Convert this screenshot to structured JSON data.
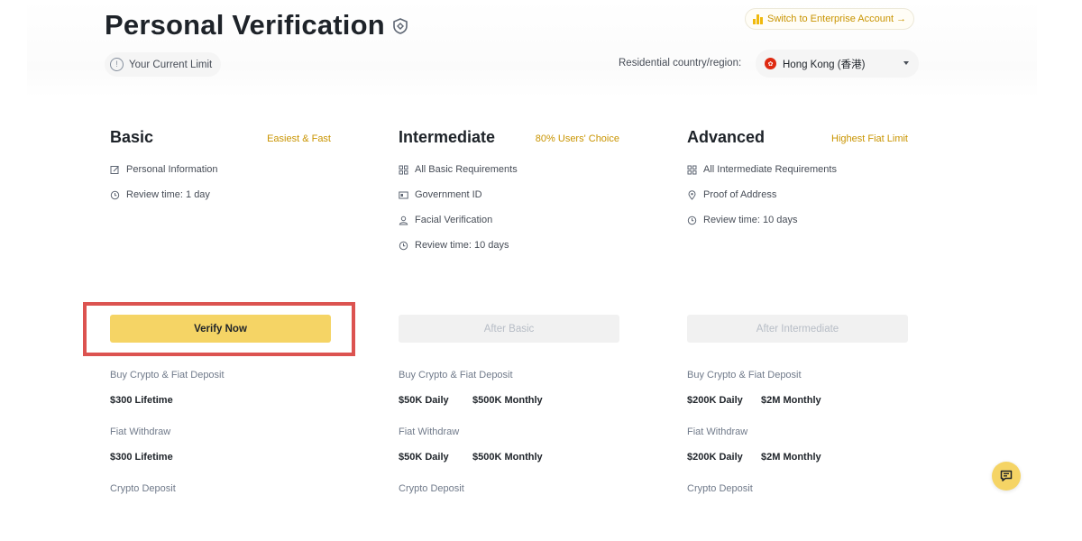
{
  "header": {
    "title": "Personal Verification",
    "current_limit": "Your Current Limit",
    "enterprise_link": "Switch to Enterprise Account →",
    "country_label": "Residential country/region:",
    "country_value": "Hong Kong (香港)"
  },
  "tiers": [
    {
      "title": "Basic",
      "tag": "Easiest & Fast",
      "requirements": [
        {
          "icon": "edit-icon",
          "text": "Personal Information"
        },
        {
          "icon": "clock-icon",
          "text": "Review time: 1 day"
        }
      ],
      "button": "Verify Now",
      "buy_label": "Buy Crypto & Fiat Deposit",
      "buy_daily": "$300 Lifetime",
      "buy_monthly": "",
      "withdraw_label": "Fiat Withdraw",
      "withdraw_daily": "$300 Lifetime",
      "withdraw_monthly": "",
      "crypto_label": "Crypto Deposit"
    },
    {
      "title": "Intermediate",
      "tag": "80% Users' Choice",
      "requirements": [
        {
          "icon": "grid-icon",
          "text": "All Basic Requirements"
        },
        {
          "icon": "id-card-icon",
          "text": "Government ID"
        },
        {
          "icon": "user-icon",
          "text": "Facial Verification"
        },
        {
          "icon": "clock-icon",
          "text": "Review time: 10 days"
        }
      ],
      "button": "After Basic",
      "buy_label": "Buy Crypto & Fiat Deposit",
      "buy_daily": "$50K Daily",
      "buy_monthly": "$500K Monthly",
      "withdraw_label": "Fiat Withdraw",
      "withdraw_daily": "$50K Daily",
      "withdraw_monthly": "$500K Monthly",
      "crypto_label": "Crypto Deposit"
    },
    {
      "title": "Advanced",
      "tag": "Highest Fiat Limit",
      "requirements": [
        {
          "icon": "grid-icon",
          "text": "All Intermediate Requirements"
        },
        {
          "icon": "location-pin-icon",
          "text": "Proof of Address"
        },
        {
          "icon": "clock-icon",
          "text": "Review time: 10 days"
        }
      ],
      "button": "After Intermediate",
      "buy_label": "Buy Crypto & Fiat Deposit",
      "buy_daily": "$200K Daily",
      "buy_monthly": "$2M Monthly",
      "withdraw_label": "Fiat Withdraw",
      "withdraw_daily": "$200K Daily",
      "withdraw_monthly": "$2M Monthly",
      "crypto_label": "Crypto Deposit"
    }
  ],
  "colors": {
    "accent": "#f0b90b",
    "button": "#f5d465",
    "tag": "#c99400",
    "highlight": "#dc5350"
  }
}
